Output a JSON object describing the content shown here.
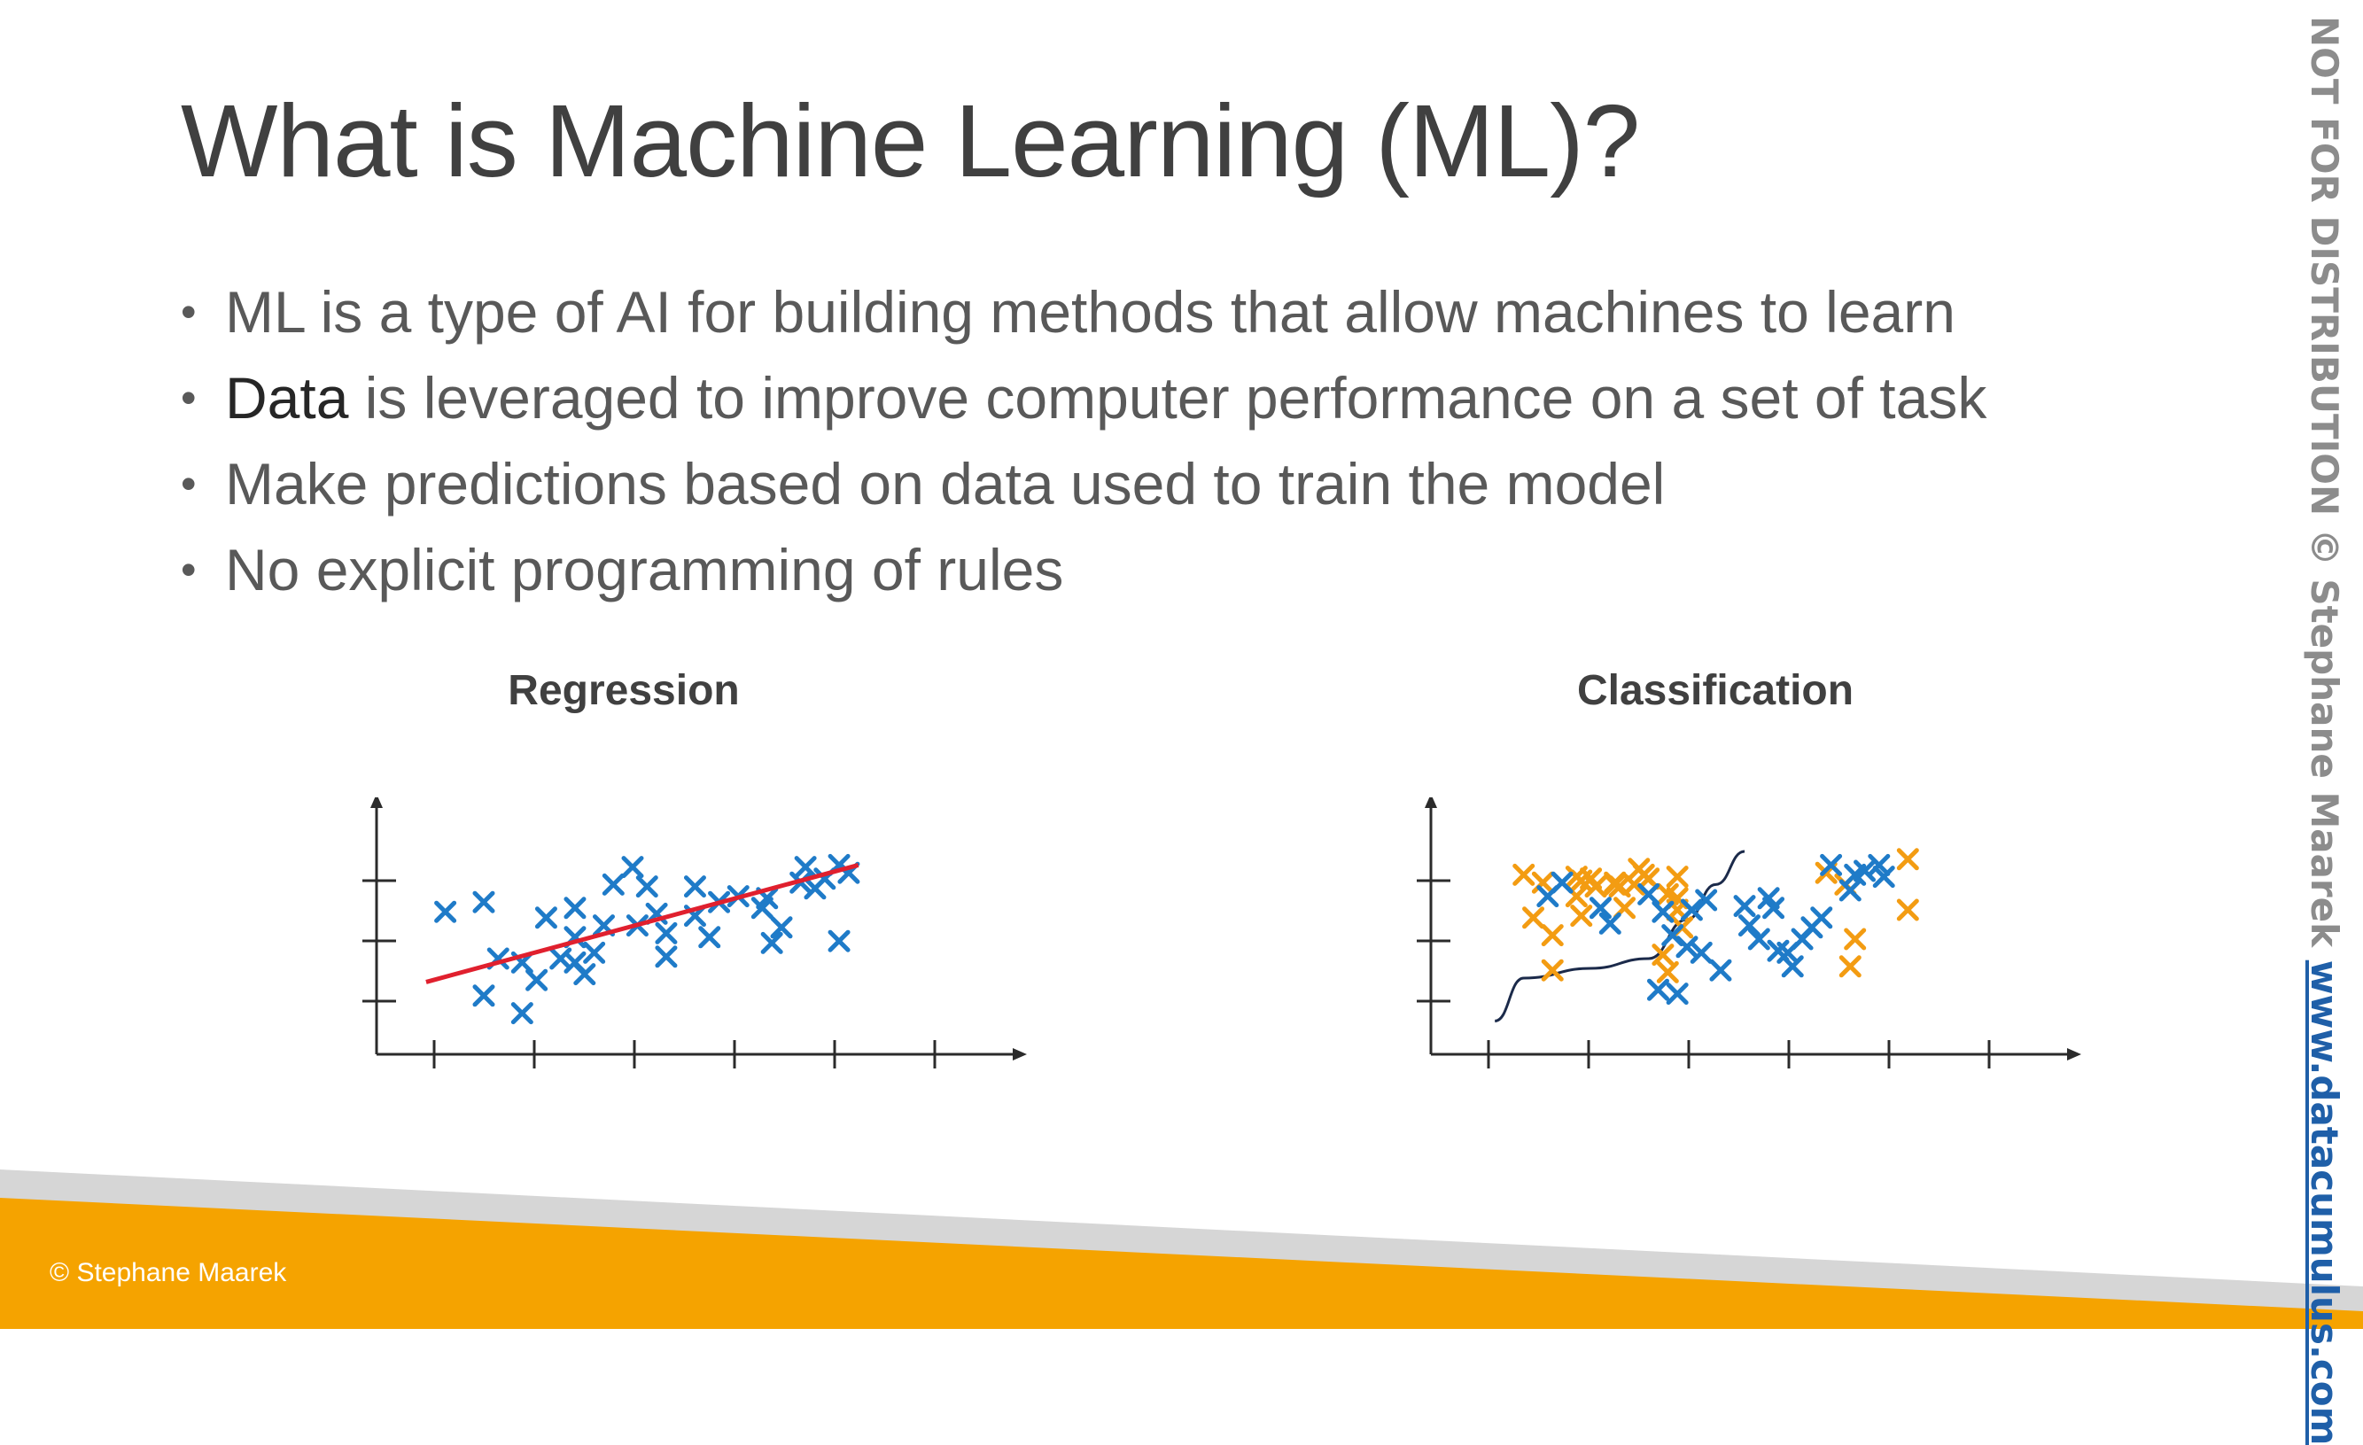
{
  "slide": {
    "title": "What is Machine Learning (ML)?",
    "bullets": [
      {
        "text": "ML is a type of AI for building methods that allow machines to learn"
      },
      {
        "emphasis": "Data",
        "text": " is leveraged to improve computer performance on a set of task"
      },
      {
        "text": "Make predictions based on data used to train the model"
      },
      {
        "text": "No explicit programming of rules"
      }
    ],
    "bullet_glyph": "•",
    "footer_copyright": "© Stephane Maarek",
    "side_notice": "NOT FOR DISTRIBUTION © Stephane Maarek",
    "side_link": "www.datacumulus.com"
  },
  "colors": {
    "accent_orange": "#F5A300",
    "blue_marker": "#1F7BC8",
    "orange_marker": "#F39C12",
    "regression_line": "#E0202E",
    "boundary_curve": "#1B2A4A",
    "axis": "#2B2B2B"
  },
  "chart_data": [
    {
      "type": "scatter",
      "title": "Regression",
      "x_ticks": 6,
      "y_ticks": 3,
      "xlim": [
        0,
        100
      ],
      "ylim": [
        0,
        100
      ],
      "series": [
        {
          "marker": "x",
          "color": "#1F7BC8",
          "points": [
            [
              11,
              64
            ],
            [
              19,
              69
            ],
            [
              19,
              21
            ],
            [
              22,
              40
            ],
            [
              27,
              38
            ],
            [
              30,
              29
            ],
            [
              27,
              12
            ],
            [
              32,
              61
            ],
            [
              35,
              40
            ],
            [
              38,
              38
            ],
            [
              38,
              66
            ],
            [
              38,
              51
            ],
            [
              40,
              32
            ],
            [
              42,
              43
            ],
            [
              44,
              57
            ],
            [
              46,
              78
            ],
            [
              50,
              87
            ],
            [
              51,
              57
            ],
            [
              53,
              77
            ],
            [
              55,
              63
            ],
            [
              57,
              41
            ],
            [
              57,
              53
            ],
            [
              63,
              77
            ],
            [
              63,
              62
            ],
            [
              66,
              51
            ],
            [
              68,
              69
            ],
            [
              72,
              72
            ],
            [
              77,
              66
            ],
            [
              78,
              71
            ],
            [
              79,
              48
            ],
            [
              81,
              56
            ],
            [
              85,
              79
            ],
            [
              86,
              87
            ],
            [
              88,
              76
            ],
            [
              90,
              81
            ],
            [
              93,
              88
            ],
            [
              95,
              84
            ],
            [
              93,
              49
            ]
          ]
        }
      ],
      "trend_line": {
        "color": "#E0202E",
        "from": [
          7,
          28
        ],
        "to": [
          97,
          88
        ]
      }
    },
    {
      "type": "scatter",
      "title": "Classification",
      "x_ticks": 6,
      "y_ticks": 3,
      "xlim": [
        0,
        100
      ],
      "ylim": [
        0,
        100
      ],
      "series": [
        {
          "marker": "x",
          "color": "#F39C12",
          "points": [
            [
              16,
              83
            ],
            [
              18,
              61
            ],
            [
              20,
              79
            ],
            [
              22,
              52
            ],
            [
              22,
              34
            ],
            [
              27,
              72
            ],
            [
              28,
              80
            ],
            [
              27,
              82
            ],
            [
              28,
              62
            ],
            [
              30,
              81
            ],
            [
              31,
              77
            ],
            [
              35,
              79
            ],
            [
              35,
              78
            ],
            [
              36,
              77
            ],
            [
              37,
              66
            ],
            [
              39,
              78
            ],
            [
              40,
              86
            ],
            [
              41,
              83
            ],
            [
              42,
              81
            ],
            [
              46,
              73
            ],
            [
              46,
              33
            ],
            [
              45,
              42
            ],
            [
              48,
              82
            ],
            [
              48,
              65
            ],
            [
              49,
              56
            ],
            [
              48,
              71
            ],
            [
              79,
              84
            ],
            [
              83,
              78
            ],
            [
              85,
              50
            ],
            [
              84,
              36
            ],
            [
              96,
              65
            ],
            [
              96,
              91
            ]
          ]
        },
        {
          "marker": "x",
          "color": "#1F7BC8",
          "points": [
            [
              21,
              72
            ],
            [
              24,
              79
            ],
            [
              32,
              66
            ],
            [
              34,
              58
            ],
            [
              42,
              73
            ],
            [
              44,
              24
            ],
            [
              45,
              64
            ],
            [
              47,
              52
            ],
            [
              48,
              22
            ],
            [
              50,
              46
            ],
            [
              51,
              65
            ],
            [
              53,
              43
            ],
            [
              54,
              70
            ],
            [
              57,
              34
            ],
            [
              62,
              67
            ],
            [
              63,
              57
            ],
            [
              65,
              50
            ],
            [
              67,
              71
            ],
            [
              68,
              66
            ],
            [
              69,
              44
            ],
            [
              71,
              43
            ],
            [
              72,
              36
            ],
            [
              74,
              50
            ],
            [
              76,
              56
            ],
            [
              78,
              61
            ],
            [
              80,
              88
            ],
            [
              84,
              75
            ],
            [
              85,
              83
            ],
            [
              87,
              85
            ],
            [
              90,
              88
            ],
            [
              91,
              82
            ]
          ]
        }
      ],
      "decision_boundary": {
        "color": "#1B2A4A",
        "points": [
          [
            10,
            8
          ],
          [
            16,
            30
          ],
          [
            30,
            35
          ],
          [
            42,
            40
          ],
          [
            50,
            60
          ],
          [
            56,
            78
          ],
          [
            62,
            95
          ]
        ]
      }
    }
  ]
}
